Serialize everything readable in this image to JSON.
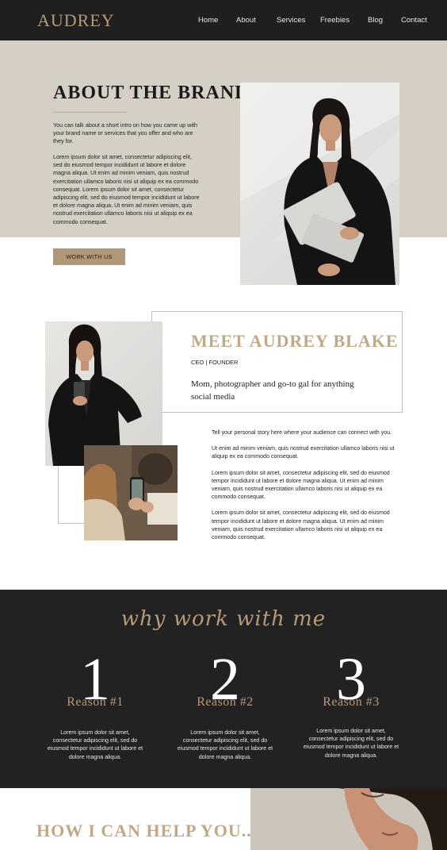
{
  "nav": {
    "logo": "AUDREY",
    "items": [
      "Home",
      "About",
      "Services",
      "Freebies",
      "Blog",
      "Contact"
    ]
  },
  "brand": {
    "title": "ABOUT THE BRAND",
    "intro": "You can talk about a short intro on how you came up with your brand name or services that you offer and who are they for.",
    "body": "Lorem ipsum dolor sit amet, consectetur adipiscing elit, sed do eiusmod tempor incididunt ut labore et dolore magna aliqua. Ut enim ad minim veniam, quis nostrud exercitation ullamco laboris nisi ut aliquip ex ea commodo consequat. Lorem ipsum dolor sit amet, consectetur adipiscing elit, sed do eiusmod tempor incididunt ut labore et dolore magna aliqua. Ut enim ad minim veniam, quis nostrud exercitation ullamco laboris nisi ut aliquip ex ea commodo consequat.",
    "button": "WORK WITH US"
  },
  "meet": {
    "title": "MEET AUDREY BLAKE",
    "role": "CEO | FOUNDER",
    "tagline": "Mom, photographer and go-to gal for anything social media",
    "paragraphs": [
      "Tell your personal story here where your audience can connect with you.",
      "Ut enim ad minim veniam, quis nostrud exercitation ullamco laboris nisi ut aliquip ex ea commodo consequat.",
      "Lorem ipsum dolor sit amet, consectetur adipiscing elit, sed do eiusmod tempor incididunt ut labore et dolore magna aliqua. Ut enim ad minim veniam, quis nostrud exercitation ullamco laboris nisi ut aliquip ex ea commodo consequat.",
      "Lorem ipsum dolor sit amet, consectetur adipiscing elit, sed do eiusmod tempor incididunt ut labore et dolore magna aliqua. Ut enim ad minim veniam, quis nostrud exercitation ullamco laboris nisi ut aliquip ex ea commodo consequat."
    ]
  },
  "why": {
    "title": "why work with me",
    "reasons": [
      {
        "num": "1",
        "label": "Reason #1",
        "text": "Lorem ipsum dolor sit amet, consectetur adipiscing elit, sed do eiusmod tempor incididunt ut labore et dolore magna aliqua."
      },
      {
        "num": "2",
        "label": "Reason #2",
        "text": "Lorem ipsum dolor sit amet, consectetur adipiscing elit, sed do eiusmod tempor incididunt ut labore et dolore magna aliqua."
      },
      {
        "num": "3",
        "label": "Reason #3",
        "text": "Lorem ipsum dolor sit amet, consectetur adipiscing elit, sed do eiusmod tempor incididunt ut labore et dolore magna aliqua."
      }
    ]
  },
  "help": {
    "title": "HOW I CAN HELP YOU..."
  },
  "colors": {
    "dark": "#1f1f1f",
    "accent": "#b59a78",
    "beige": "#d6cfc6"
  }
}
